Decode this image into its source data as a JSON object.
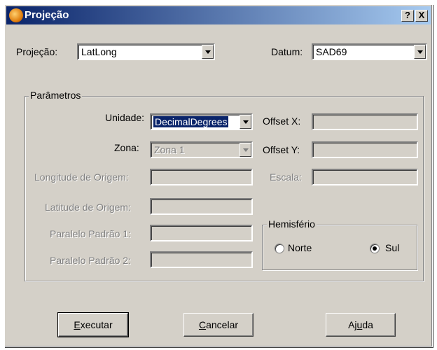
{
  "window": {
    "title": "Projeção",
    "help_button": "?",
    "close_button": "X"
  },
  "projection": {
    "label": "Projeção:",
    "value": "LatLong"
  },
  "datum": {
    "label": "Datum:",
    "value": "SAD69"
  },
  "params": {
    "title": "Parâmetros",
    "unidade_label": "Unidade:",
    "unidade_value": "DecimalDegrees",
    "zona_label": "Zona:",
    "zona_value": "Zona 1",
    "longitude_label": "Longitude de Origem:",
    "latitude_label": "Latitude de Origem:",
    "paralelo1_label": "Paralelo Padrão 1:",
    "paralelo2_label": "Paralelo Padrão 2:",
    "offset_x_label": "Offset X:",
    "offset_y_label": "Offset Y:",
    "escala_label": "Escala:",
    "hemisferio": {
      "title": "Hemisfério",
      "norte": "Norte",
      "sul": "Sul",
      "selected": "Sul"
    }
  },
  "buttons": {
    "executar_mnemonic": "E",
    "executar_rest": "xecutar",
    "cancelar_mnemonic": "C",
    "cancelar_rest": "ancelar",
    "ajuda_before": "Aj",
    "ajuda_mnemonic": "u",
    "ajuda_after": "da"
  },
  "colors": {
    "face": "#d4d0c8",
    "title_start": "#0a246a",
    "title_end": "#a6caf0",
    "disabled_text": "#808080"
  }
}
